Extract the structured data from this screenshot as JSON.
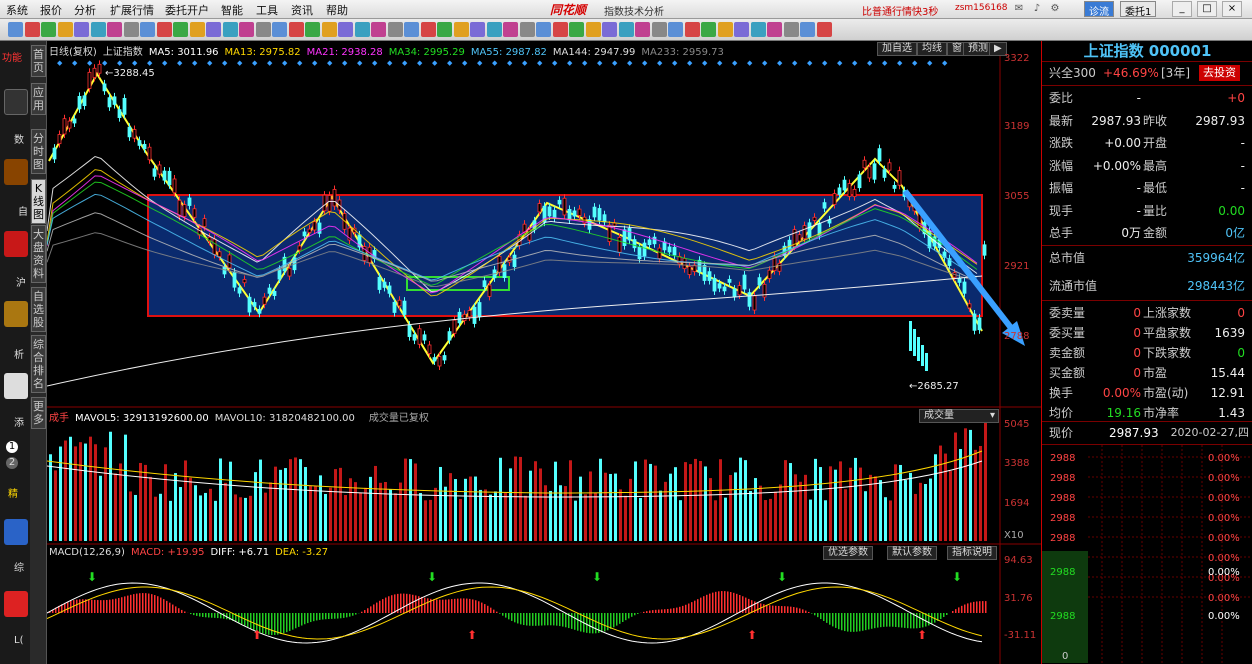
{
  "menu": {
    "items": [
      "系统",
      "报价",
      "分析",
      "扩展行情",
      "委托开户",
      "智能",
      "工具",
      "资讯",
      "帮助"
    ],
    "brand": "同花顺",
    "app_name": "指数技术分析",
    "promo": "比普通行情快3秒",
    "user": "zsm156168",
    "btn_login": "诊流",
    "btn_trade": "委托1",
    "win_buttons": [
      "_",
      "□",
      "×"
    ]
  },
  "left_strip": {
    "labels": [
      "功能",
      "数",
      "自",
      "沪",
      "析",
      "添",
      "1",
      "2",
      "精",
      "综",
      "L("
    ]
  },
  "vtabs": [
    "首页",
    "应用",
    "分时图",
    "K线图",
    "大盘资料",
    "自选股",
    "综合排名",
    "更多"
  ],
  "chart": {
    "header": {
      "label": "日线(复权)",
      "index": "上证指数",
      "ma5": "MA5: 3011.96",
      "ma13": "MA13: 2975.82",
      "ma21": "MA21: 2938.28",
      "ma34": "MA34: 2995.29",
      "ma55": "MA55: 2987.82",
      "ma144": "MA144: 2947.99",
      "ma233": "MA233: 2959.73",
      "btn_add": "加自选",
      "btn_wave": "均线",
      "btn_window": "窗",
      "btn_predict": "预测"
    },
    "price_axis": [
      "3322",
      "3189",
      "3055",
      "2921",
      "2788"
    ],
    "high_label": "3288.45",
    "low_label": "2685.27",
    "volume": {
      "title": "成手",
      "mavol5": "MAVOL5: 32913192600.00",
      "mavol10": "MAVOL10: 31820482100.00",
      "note": "成交量已复权",
      "selector": "成交量",
      "axis": [
        "5045",
        "3388",
        "1694",
        "X10"
      ]
    },
    "macd": {
      "title": "MACD(12,26,9)",
      "macd": "MACD: +19.95",
      "diff": "DIFF: +6.71",
      "dea": "DEA: -3.27",
      "btn_opt": "优选参数",
      "btn_default": "默认参数",
      "btn_help": "指标说明",
      "axis": [
        "94.63",
        "31.76",
        "-31.11"
      ]
    },
    "colors": {
      "up": "#ff3030",
      "down": "#54ffff",
      "box_fill": "#0a2a6e",
      "box_border": "#e01010",
      "zigzag": "#ffff33",
      "arrow": "#3aa0ff"
    }
  },
  "panel": {
    "title": "上证指数 000001",
    "hs300": "兴全300",
    "hs300_change": "+46.69%",
    "hs300_period": "[3年]",
    "hs300_btn": "去投资",
    "rows": [
      {
        "l1": "委比",
        "v1": "-",
        "l2": "",
        "v2": "+0"
      },
      {
        "l1": "最新",
        "v1": "2987.93",
        "l2": "昨收",
        "v2": "2987.93"
      },
      {
        "l1": "涨跌",
        "v1": "+0.00",
        "l2": "开盘",
        "v2": "-"
      },
      {
        "l1": "涨幅",
        "v1": "+0.00%",
        "l2": "最高",
        "v2": "-"
      },
      {
        "l1": "振幅",
        "v1": "-",
        "l2": "最低",
        "v2": "-"
      },
      {
        "l1": "现手",
        "v1": "-",
        "l2": "量比",
        "v2": "0.00"
      },
      {
        "l1": "总手",
        "v1": "0万",
        "l2": "金额",
        "v2": "0亿"
      }
    ],
    "total_cap_label": "总市值",
    "total_cap": "359964亿",
    "float_cap_label": "流通市值",
    "float_cap": "298443亿",
    "rows2": [
      {
        "l1": "委卖量",
        "v1": "0",
        "l2": "上涨家数",
        "v2": "0"
      },
      {
        "l1": "委买量",
        "v1": "0",
        "l2": "平盘家数",
        "v2": "1639"
      },
      {
        "l1": "卖金额",
        "v1": "0",
        "l2": "下跌家数",
        "v2": "0"
      },
      {
        "l1": "买金额",
        "v1": "0",
        "l2": "市盈",
        "v2": "15.44"
      },
      {
        "l1": "换手",
        "v1": "0.00%",
        "l2": "市盈(动)",
        "v2": "12.91"
      },
      {
        "l1": "均价",
        "v1": "19.16",
        "l2": "市净率",
        "v2": "1.43"
      }
    ],
    "now_label": "现价",
    "now_value": "2987.93",
    "now_date": "2020-02-27,四",
    "ladder_prices": [
      "2988",
      "2988",
      "2988",
      "2988",
      "2988",
      "2988",
      "2988",
      "2988"
    ],
    "ladder_pcts": [
      "0.00%",
      "0.00%",
      "0.00%",
      "0.00%",
      "0.00%",
      "0.00%",
      "0.00%",
      "0.00%"
    ],
    "ladder_axis": [
      "2988",
      "2988",
      "0"
    ]
  }
}
